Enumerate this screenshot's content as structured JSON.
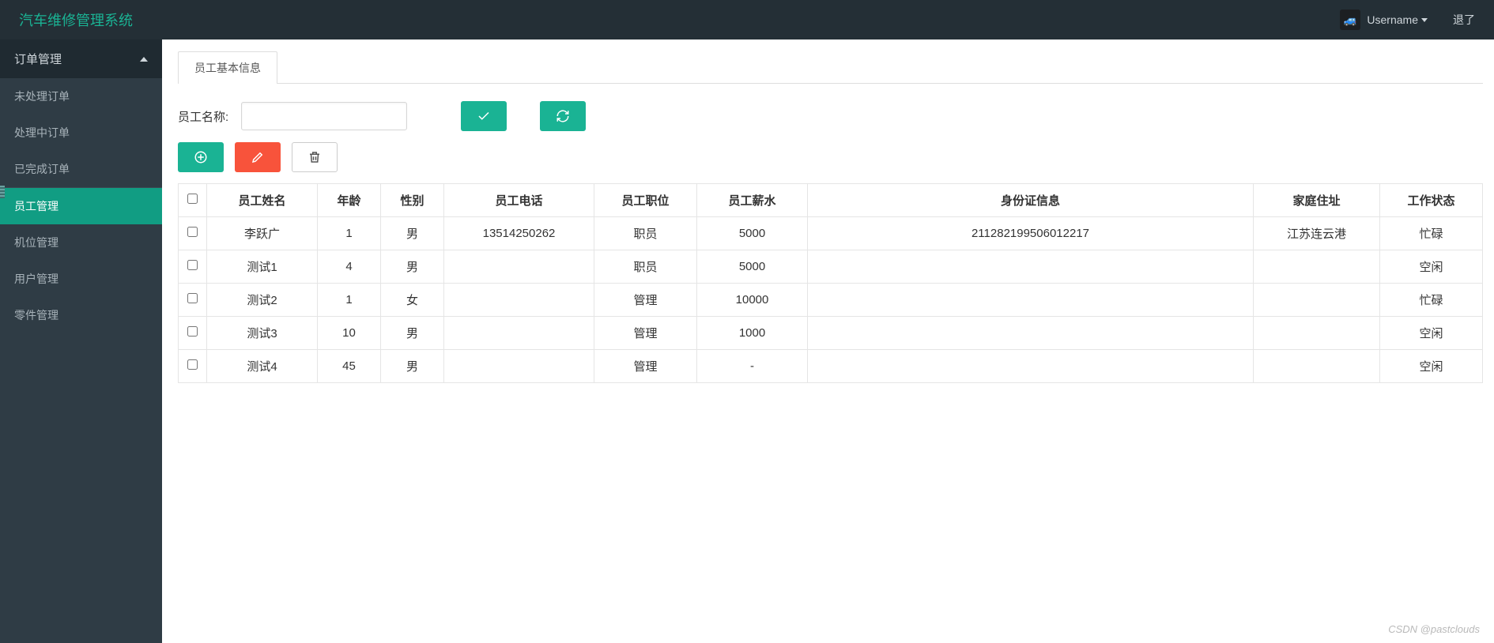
{
  "colors": {
    "accent": "#1ab394",
    "danger": "#f8533b",
    "busy": "#e74c3c",
    "idle": "#1a9e3c"
  },
  "header": {
    "brand": "汽车维修管理系统",
    "username": "Username",
    "logout": "退了",
    "avatar_emoji": "🚙"
  },
  "sidebar": {
    "top_group": {
      "label": "订单管理",
      "expanded": true
    },
    "order_children": [
      {
        "id": "pending",
        "label": "未处理订单"
      },
      {
        "id": "processing",
        "label": "处理中订单"
      },
      {
        "id": "done",
        "label": "已完成订单"
      }
    ],
    "items": [
      {
        "id": "staff",
        "label": "员工管理",
        "active": true
      },
      {
        "id": "station",
        "label": "机位管理"
      },
      {
        "id": "user",
        "label": "用户管理"
      },
      {
        "id": "parts",
        "label": "零件管理"
      }
    ]
  },
  "tab": {
    "label": "员工基本信息"
  },
  "filter": {
    "label": "员工名称:",
    "value": ""
  },
  "buttons": {
    "confirm_icon": "check",
    "refresh_icon": "refresh",
    "add_icon": "plus-circle",
    "edit_icon": "pencil",
    "delete_icon": "trash"
  },
  "table": {
    "headers": [
      "员工姓名",
      "年龄",
      "性别",
      "员工电话",
      "员工职位",
      "员工薪水",
      "身份证信息",
      "家庭住址",
      "工作状态"
    ],
    "status_labels": {
      "busy": "忙碌",
      "idle": "空闲"
    },
    "rows": [
      {
        "name": "李跃广",
        "age": "1",
        "gender": "男",
        "phone": "13514250262",
        "position": "职员",
        "salary": "5000",
        "id_card": "211282199506012217",
        "address": "江苏连云港",
        "status": "busy"
      },
      {
        "name": "测试1",
        "age": "4",
        "gender": "男",
        "phone": "",
        "position": "职员",
        "salary": "5000",
        "id_card": "",
        "address": "",
        "status": "idle"
      },
      {
        "name": "测试2",
        "age": "1",
        "gender": "女",
        "phone": "",
        "position": "管理",
        "salary": "10000",
        "id_card": "",
        "address": "",
        "status": "busy"
      },
      {
        "name": "测试3",
        "age": "10",
        "gender": "男",
        "phone": "",
        "position": "管理",
        "salary": "1000",
        "id_card": "",
        "address": "",
        "status": "idle"
      },
      {
        "name": "测试4",
        "age": "45",
        "gender": "男",
        "phone": "",
        "position": "管理",
        "salary": "-",
        "id_card": "",
        "address": "",
        "status": "idle"
      }
    ]
  },
  "watermark": "CSDN @pastclouds"
}
